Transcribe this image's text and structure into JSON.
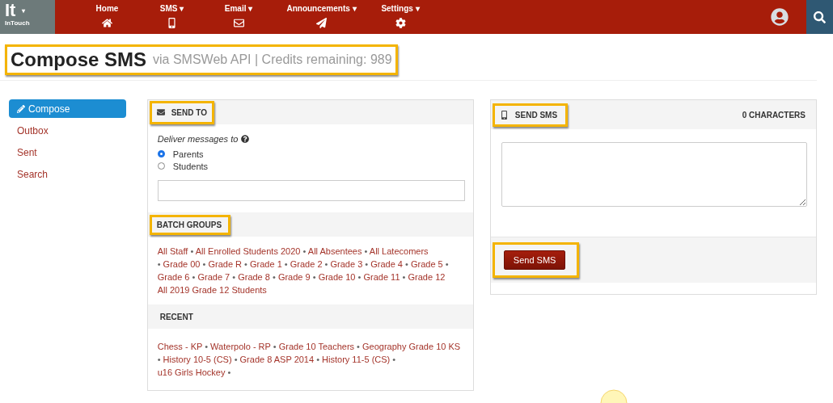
{
  "navbar": {
    "logo": {
      "mark": "It",
      "caret": "▾",
      "name": "InTouch"
    },
    "items": [
      {
        "label": "Home"
      },
      {
        "label": "SMS",
        "caret": "▾"
      },
      {
        "label": "Email",
        "caret": "▾"
      },
      {
        "label": "Announcements",
        "caret": "▾"
      },
      {
        "label": "Settings",
        "caret": "▾"
      }
    ]
  },
  "page_header": {
    "title": "Compose SMS",
    "subtitle": "via SMSWeb API | Credits remaining: 989",
    "highlighted": true
  },
  "sidebar": {
    "items": [
      {
        "label": "Compose",
        "selected": true
      },
      {
        "label": "Outbox",
        "selected": false
      },
      {
        "label": "Sent",
        "selected": false
      },
      {
        "label": "Search",
        "selected": false
      }
    ]
  },
  "send_to": {
    "title": "SEND TO",
    "highlighted": true,
    "prompt": "Deliver messages to",
    "options": [
      {
        "label": "Parents",
        "selected": true
      },
      {
        "label": "Students",
        "selected": false
      }
    ],
    "batch_groups": {
      "title": "BATCH GROUPS",
      "highlighted": true,
      "separator": "•",
      "rows": [
        {
          "items": [
            "All Staff",
            "All Enrolled Students 2020",
            "All Absentees",
            "All Latecomers"
          ]
        },
        {
          "prefix": "•",
          "items": [
            "Grade 00",
            "Grade R",
            "Grade 1",
            "Grade 2",
            "Grade 3",
            "Grade 4",
            "Grade 5",
            "Grade 6",
            "Grade 7",
            "Grade 8",
            "Grade 9",
            "Grade 10",
            "Grade 11",
            "Grade 12"
          ]
        },
        {
          "items": [
            "All 2019 Grade 12 Students"
          ]
        }
      ]
    },
    "recent": {
      "title": "RECENT",
      "separator": "•",
      "items": [
        "Chess - KP",
        "Waterpolo - RP",
        "Grade 10 Teachers",
        "Geography Grade 10 KS",
        "History 10-5 (CS)",
        "Grade 8 ASP 2014",
        "History 11-5 (CS)",
        "u16 Girls Hockey"
      ]
    }
  },
  "send_sms": {
    "title": "SEND SMS",
    "highlighted": true,
    "counter": "0 CHARACTERS",
    "button": {
      "label": "Send SMS",
      "highlighted": true
    }
  }
}
